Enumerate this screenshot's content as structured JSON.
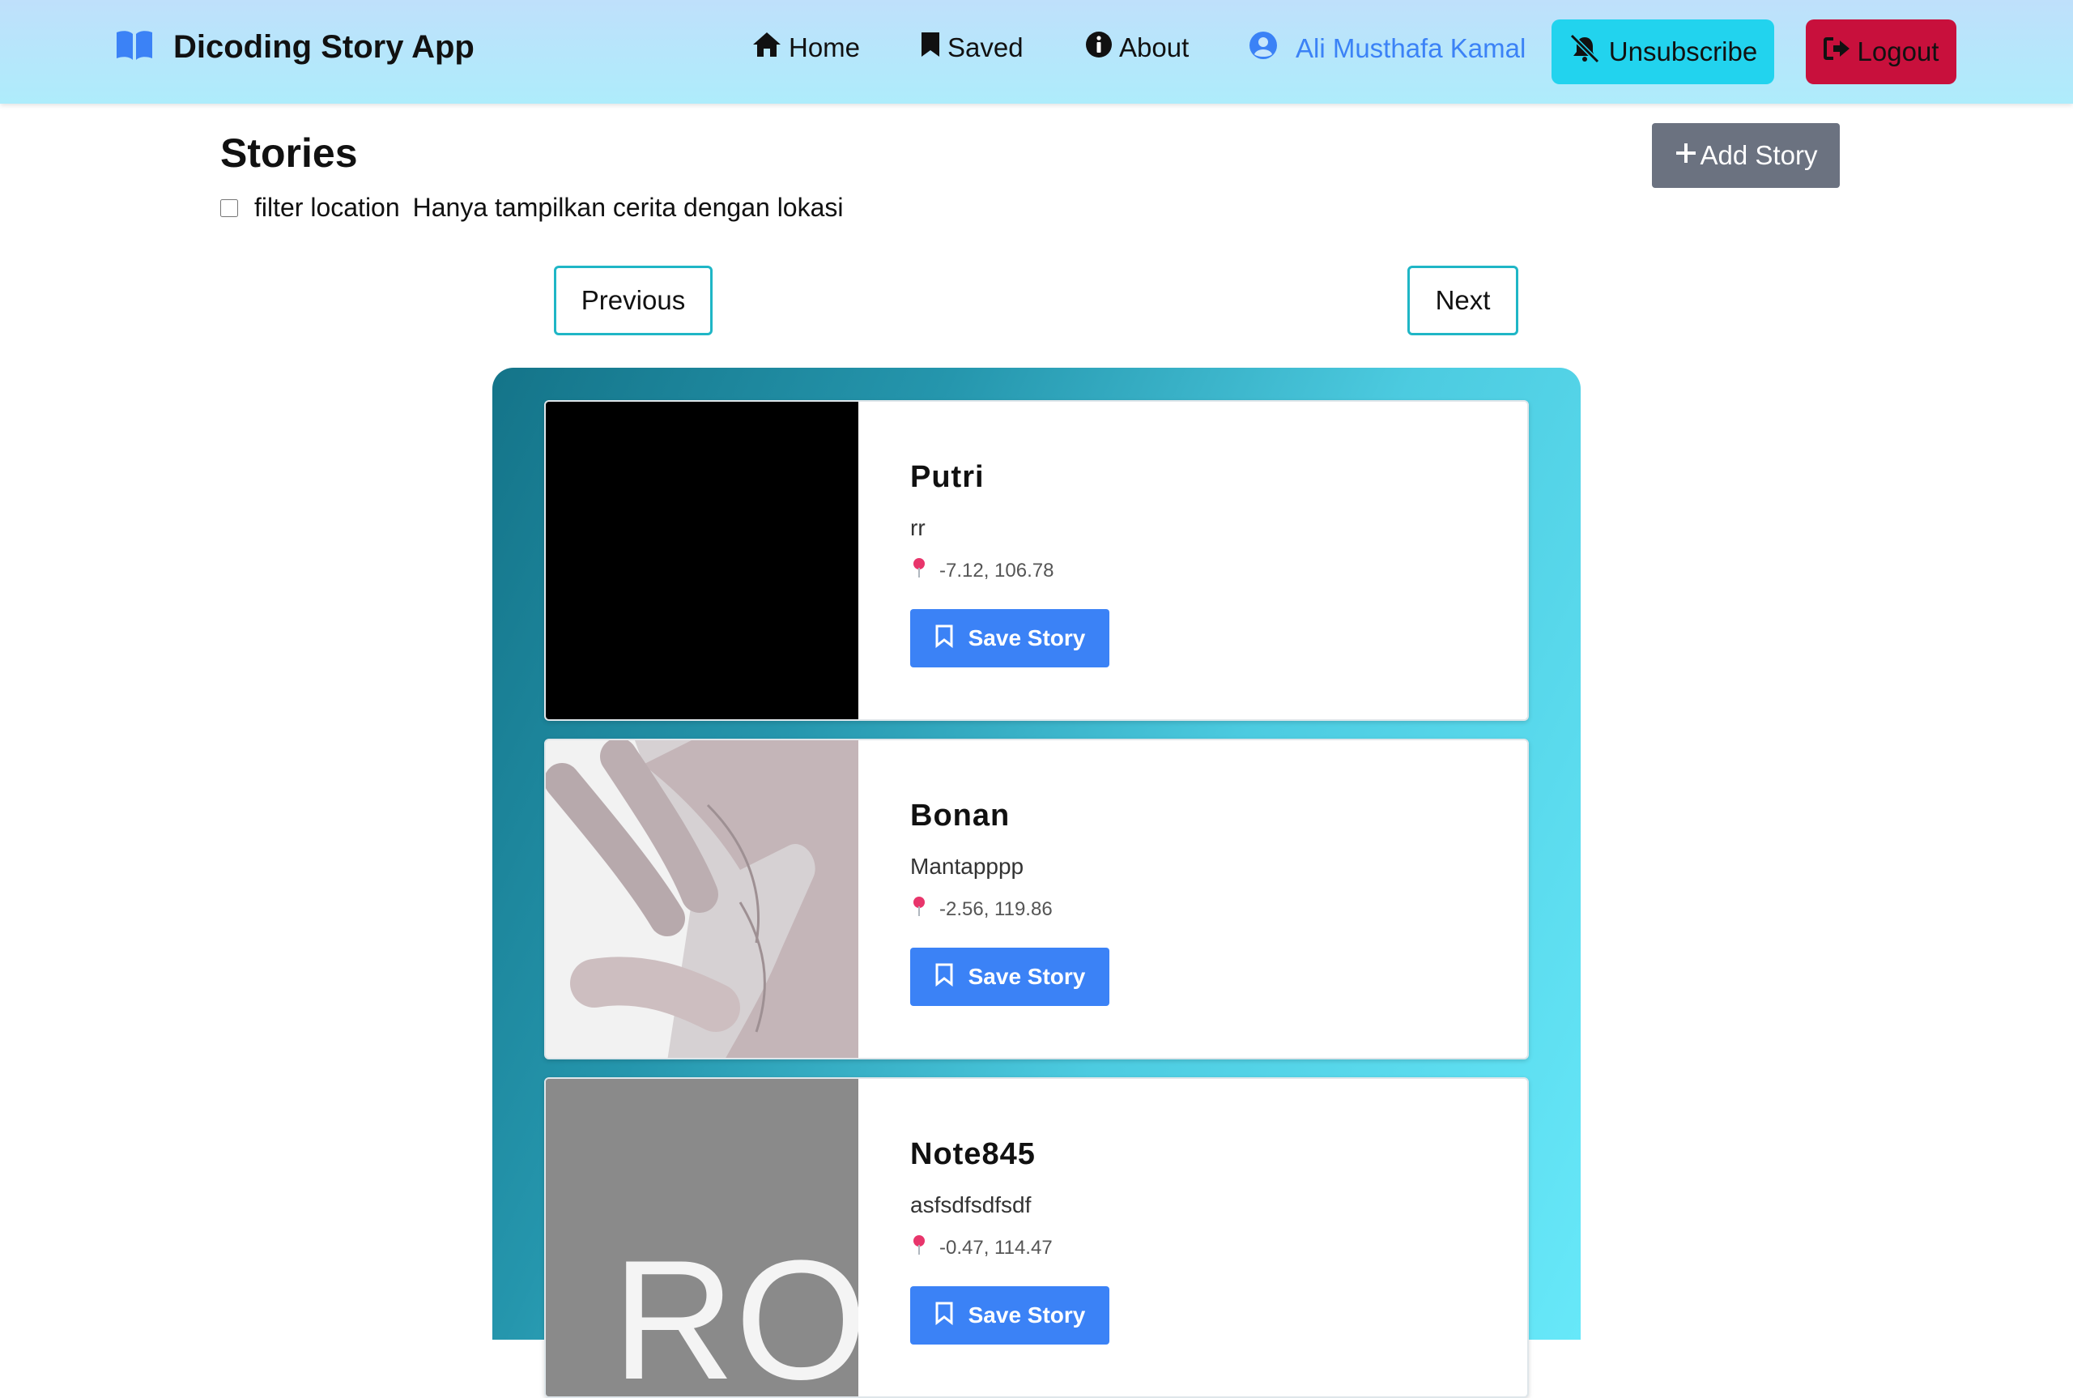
{
  "nav": {
    "brand_title": "Dicoding Story App",
    "home_label": "Home",
    "saved_label": "Saved",
    "about_label": "About",
    "user_name": "Ali Musthafa Kamal",
    "unsubscribe_label": "Unsubscribe",
    "logout_label": "Logout"
  },
  "page": {
    "title": "Stories",
    "filter_label": "filter location",
    "filter_hint": "Hanya tampilkan cerita dengan lokasi",
    "filter_checked": false,
    "add_story_label": "Add Story",
    "previous_label": "Previous",
    "next_label": "Next"
  },
  "stories": [
    {
      "name": "Putri",
      "description": "rr",
      "location": "-7.12, 106.78",
      "save_label": "Save Story"
    },
    {
      "name": "Bonan",
      "description": "Mantapppp",
      "location": "-2.56, 119.86",
      "save_label": "Save Story"
    },
    {
      "name": "Note845",
      "description": "asfsdfsdfsdf",
      "location": "-0.47, 114.47",
      "save_label": "Save Story",
      "image_text": "RO"
    }
  ],
  "colors": {
    "accent_blue": "#3b82f6",
    "unsubscribe_bg": "#22d3ee",
    "logout_bg": "#c8103c",
    "add_story_bg": "#6b7280",
    "pagination_border": "#1fb6c6"
  }
}
